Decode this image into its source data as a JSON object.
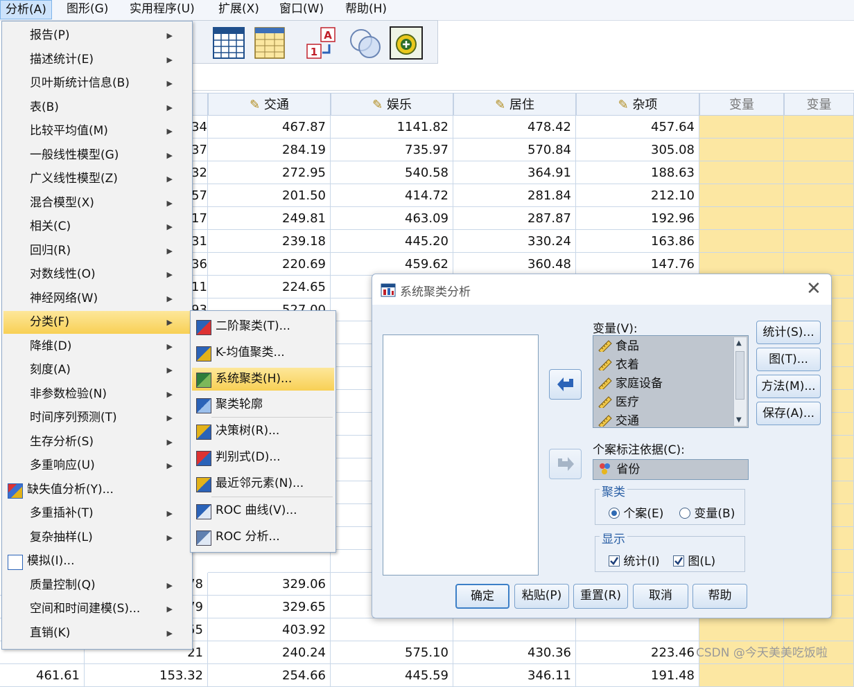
{
  "menubar": [
    "分析(A)",
    "图形(G)",
    "实用程序(U)",
    "扩展(X)",
    "窗口(W)",
    "帮助(H)"
  ],
  "analyze_menu": [
    {
      "label": "报告(P)",
      "arrow": true
    },
    {
      "label": "描述统计(E)",
      "arrow": true
    },
    {
      "label": "贝叶斯统计信息(B)",
      "arrow": true
    },
    {
      "label": "表(B)",
      "arrow": true
    },
    {
      "label": "比较平均值(M)",
      "arrow": true
    },
    {
      "label": "一般线性模型(G)",
      "arrow": true
    },
    {
      "label": "广义线性模型(Z)",
      "arrow": true
    },
    {
      "label": "混合模型(X)",
      "arrow": true
    },
    {
      "label": "相关(C)",
      "arrow": true
    },
    {
      "label": "回归(R)",
      "arrow": true
    },
    {
      "label": "对数线性(O)",
      "arrow": true
    },
    {
      "label": "神经网络(W)",
      "arrow": true
    },
    {
      "label": "分类(F)",
      "arrow": true
    },
    {
      "label": "降维(D)",
      "arrow": true
    },
    {
      "label": "刻度(A)",
      "arrow": true
    },
    {
      "label": "非参数检验(N)",
      "arrow": true
    },
    {
      "label": "时间序列预测(T)",
      "arrow": true
    },
    {
      "label": "生存分析(S)",
      "arrow": true
    },
    {
      "label": "多重响应(U)",
      "arrow": true
    },
    {
      "label": "缺失值分析(Y)...",
      "arrow": false
    },
    {
      "label": "多重插补(T)",
      "arrow": true
    },
    {
      "label": "复杂抽样(L)",
      "arrow": true
    },
    {
      "label": "模拟(I)...",
      "arrow": false
    },
    {
      "label": "质量控制(Q)",
      "arrow": true
    },
    {
      "label": "空间和时间建模(S)...",
      "arrow": true
    },
    {
      "label": "直销(K)",
      "arrow": true
    }
  ],
  "classify_menu": [
    "二阶聚类(T)...",
    "K-均值聚类...",
    "系统聚类(H)...",
    "聚类轮廓",
    "决策树(R)...",
    "判别式(D)...",
    "最近邻元素(N)...",
    "ROC 曲线(V)...",
    "ROC 分析..."
  ],
  "grid": {
    "headers": [
      "交通",
      "娱乐",
      "居住",
      "杂项",
      "变量",
      "变量"
    ],
    "clipped_col": [
      "34",
      "37",
      "32",
      "57",
      "17",
      "31",
      "36",
      "11",
      "93"
    ],
    "rows": [
      [
        "467.87",
        "1141.82",
        "478.42",
        "457.64"
      ],
      [
        "284.19",
        "735.97",
        "570.84",
        "305.08"
      ],
      [
        "272.95",
        "540.58",
        "364.91",
        "188.63"
      ],
      [
        "201.50",
        "414.72",
        "281.84",
        "212.10"
      ],
      [
        "249.81",
        "463.09",
        "287.87",
        "192.96"
      ],
      [
        "239.18",
        "445.20",
        "330.24",
        "163.86"
      ],
      [
        "220.69",
        "459.62",
        "360.48",
        "147.76"
      ],
      [
        "224.65",
        "",
        "",
        ""
      ],
      [
        "527.00",
        "",
        "",
        ""
      ]
    ],
    "bottom_rows": [
      {
        "a": "",
        "b": "78",
        "c": "329.06",
        "d": "",
        "e": "",
        "f": ""
      },
      {
        "a": "",
        "b": "79",
        "c": "329.65",
        "d": "",
        "e": "",
        "f": ""
      },
      {
        "a": "",
        "b": "55",
        "c": "403.92",
        "d": "",
        "e": "",
        "f": ""
      },
      {
        "a": "",
        "b": "21",
        "c": "240.24",
        "d": "575.10",
        "e": "430.36",
        "f": "223.46"
      },
      {
        "a": "461.61",
        "b": "153.32",
        "c": "254.66",
        "d": "445.59",
        "e": "346.11",
        "f": "191.48"
      }
    ]
  },
  "dialog": {
    "title": "系统聚类分析",
    "variables_label": "变量(V):",
    "variables": [
      "食品",
      "衣着",
      "家庭设备",
      "医疗",
      "交通"
    ],
    "case_label_label": "个案标注依据(C):",
    "case_label_value": "省份",
    "cluster_group": "聚类",
    "radio_cases": "个案(E)",
    "radio_variables": "变量(B)",
    "display_group": "显示",
    "check_stats": "统计(I)",
    "check_plots": "图(L)",
    "side_buttons": [
      "统计(S)...",
      "图(T)...",
      "方法(M)...",
      "保存(A)..."
    ],
    "bottom_buttons": [
      "确定",
      "粘贴(P)",
      "重置(R)",
      "取消",
      "帮助"
    ]
  },
  "watermark": "CSDN @今天美美吃饭啦"
}
